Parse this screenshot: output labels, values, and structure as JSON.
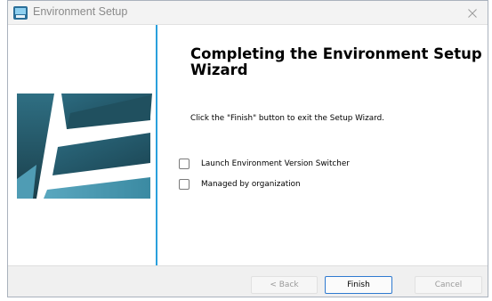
{
  "window": {
    "title": "Environment Setup",
    "app_icon": "installer-icon",
    "close_icon": "close-icon"
  },
  "wizard": {
    "heading": "Completing the Environment Setup Wizard",
    "message": "Click the \"Finish\" button to exit the Setup Wizard.",
    "options": [
      {
        "label": "Launch Environment Version Switcher",
        "checked": false
      },
      {
        "label": "Managed by organization",
        "checked": false
      }
    ]
  },
  "footer": {
    "back_label": "< Back",
    "finish_label": "Finish",
    "cancel_label": "Cancel"
  },
  "colors": {
    "accent_divider": "#2aa0dc",
    "graphic_dark": "#1f4e5c",
    "graphic_mid": "#2d7187",
    "graphic_light": "#4a96ad",
    "finish_border": "#2f7ad0"
  }
}
